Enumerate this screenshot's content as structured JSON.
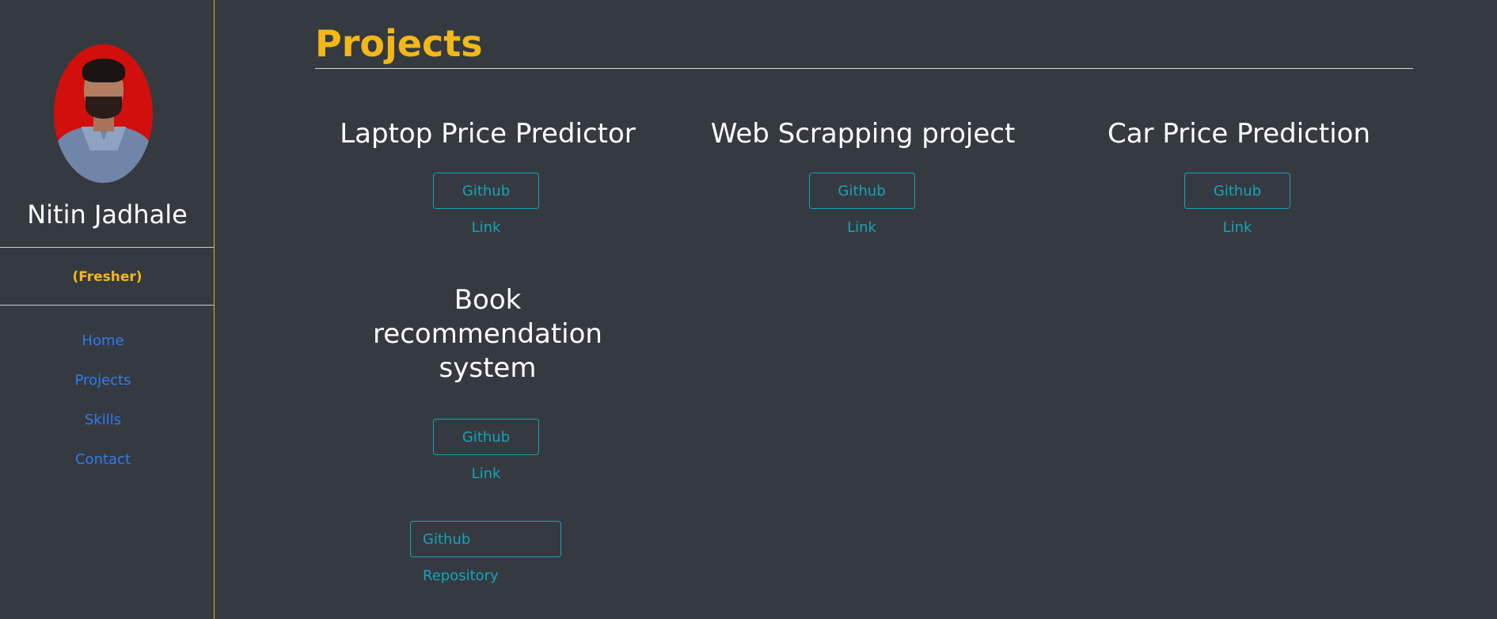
{
  "sidebar": {
    "name": "Nitin Jadhale",
    "status": "(Fresher)",
    "nav": [
      {
        "label": "Home"
      },
      {
        "label": "Projects"
      },
      {
        "label": "Skills"
      },
      {
        "label": "Contact"
      }
    ]
  },
  "main": {
    "title": "Projects",
    "projects": [
      {
        "title": "Laptop Price Predictor",
        "link_label": "Github Link"
      },
      {
        "title": "Web Scrapping project",
        "link_label": "Github Link"
      },
      {
        "title": "Car Price Prediction",
        "link_label": "Github Link"
      },
      {
        "title": "Book recommendation system",
        "link_label": "Github Link"
      }
    ],
    "repository_label": "Github Repository"
  },
  "colors": {
    "background": "#353a41",
    "accent": "#f3b718",
    "nav_link": "#2d7cf1",
    "button_outline": "#17a2b8"
  }
}
